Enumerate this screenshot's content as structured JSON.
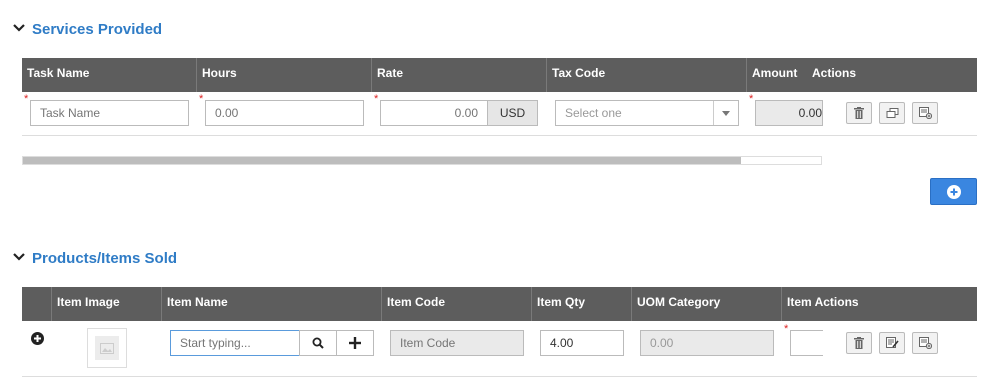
{
  "services": {
    "title": "Services Provided",
    "columns": [
      "Task Name",
      "Hours",
      "Rate",
      "Tax Code",
      "Amount",
      "Actions"
    ],
    "row": {
      "task_placeholder": "Task Name",
      "hours_placeholder": "0.00",
      "rate_placeholder": "0.00",
      "currency": "USD",
      "tax_select_value": "Select one",
      "amount_value": "0.00"
    },
    "scrollbar_fraction": 0.9
  },
  "products": {
    "title": "Products/Items Sold",
    "columns": [
      "Item Image",
      "Item Name",
      "Item Code",
      "Item Qty",
      "UOM Category",
      "Item Actions"
    ],
    "row": {
      "item_name_placeholder": "Start typing...",
      "item_code_placeholder": "Item Code",
      "item_qty_value": "4.00",
      "uom_value": "0.00"
    }
  },
  "colors": {
    "accent": "#2f7cc6",
    "header_bg": "#5d5d5d",
    "add_button": "#3a86e0"
  },
  "icons": [
    "chevron-down-icon",
    "trash-icon",
    "copy-icon",
    "add-row-icon",
    "plus-circle-icon",
    "search-icon",
    "plus-icon",
    "image-placeholder-icon",
    "edit-icon"
  ]
}
